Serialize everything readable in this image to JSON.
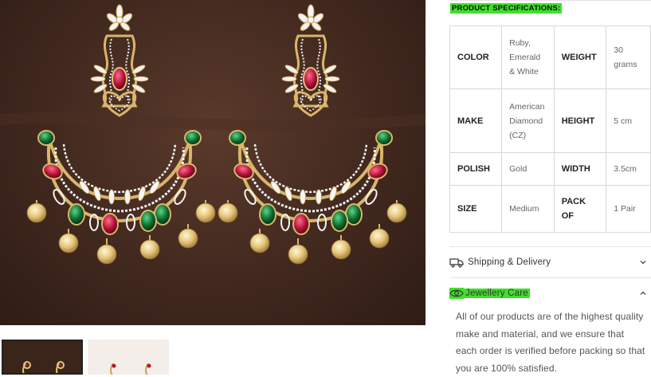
{
  "product_specifications": {
    "heading": "PRODUCT SPECIFICATIONS:",
    "rows": [
      {
        "label1": "COLOR",
        "value1": "Ruby, Emerald & White",
        "label2": "WEIGHT",
        "value2": "30 grams"
      },
      {
        "label1": "MAKE",
        "value1": "American Diamond (CZ)",
        "label2": "HEIGHT",
        "value2": "5 cm"
      },
      {
        "label1": "POLISH",
        "value1": "Gold",
        "label2": "WIDTH",
        "value2": "3.5cm"
      },
      {
        "label1": "SIZE",
        "value1": "Medium",
        "label2": "PACK OF",
        "value2": "1 Pair"
      }
    ]
  },
  "accordion": {
    "shipping": {
      "label": "Shipping & Delivery",
      "icon": "truck-icon",
      "expanded": false
    },
    "care": {
      "label": "Jewellery Care",
      "icon": "eye-icon",
      "expanded": true,
      "body": "All of our products are of the highest quality make and material, and we ensure that each order is verified before packing so that you are 100% satisfied."
    }
  },
  "colors": {
    "highlight": "#3fe02a",
    "background_brown": "#3f271d",
    "gold": "#d9b66a",
    "ruby": "#b3123a",
    "emerald": "#0f6b2e"
  }
}
